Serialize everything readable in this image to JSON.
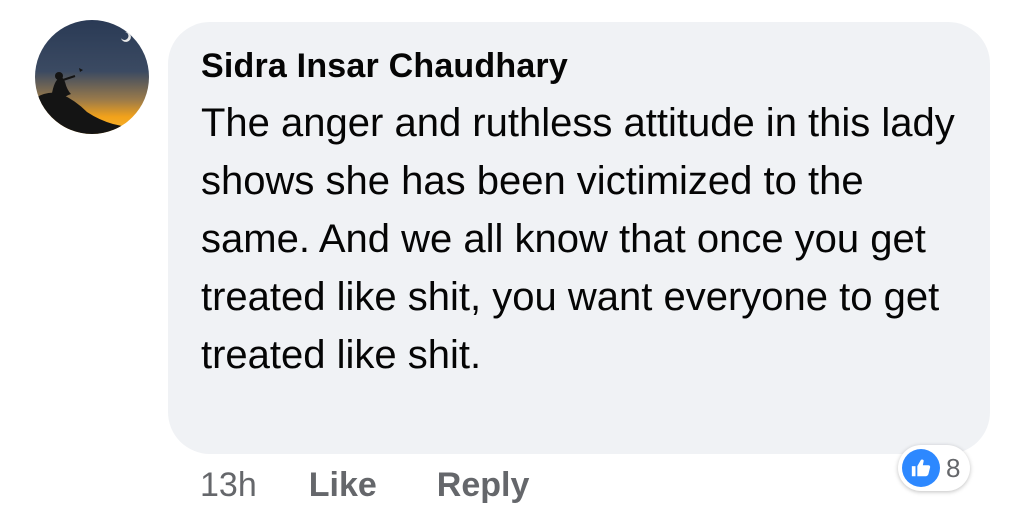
{
  "comment": {
    "author": "Sidra Insar Chaudhary",
    "text": "The anger and ruthless attitude in this lady shows she has been victimized to the same. And we all know that once you get treated like shit, you want everyone to get treated like shit.",
    "bubble_color": "#f0f2f5"
  },
  "actions": {
    "time": "13h",
    "like_label": "Like",
    "reply_label": "Reply",
    "text_color": "#65676b"
  },
  "reactions": {
    "icon": "thumbs-up-icon",
    "count": "8",
    "accent": "#2d88ff"
  }
}
